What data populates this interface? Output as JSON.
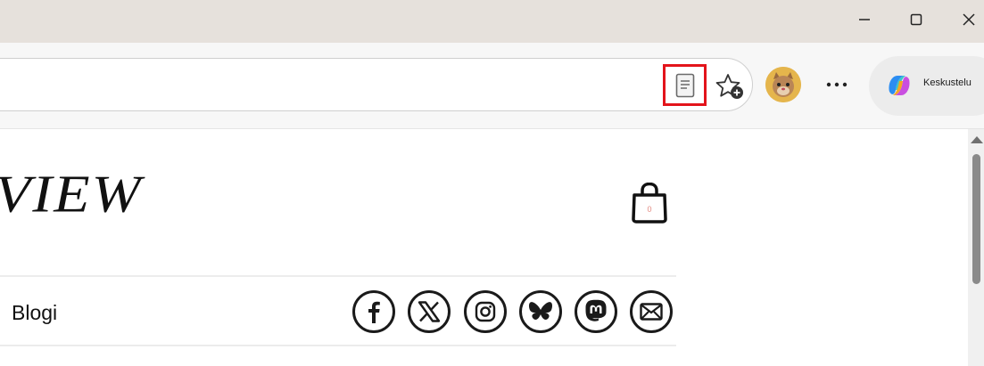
{
  "window": {
    "controls": [
      "minimize-icon",
      "maximize-icon",
      "close-icon"
    ]
  },
  "toolbar": {
    "reader_icon": "reader-view-icon",
    "favorites_icon": "add-favorite-icon",
    "profile_icon": "profile-avatar-icon",
    "more_icon": "more-options-icon",
    "copilot_label": "Keskustelu"
  },
  "page": {
    "logo_text": "VIEW",
    "bag_icon": "shopping-bag-icon",
    "nav_label": "Blogi",
    "social_icons": [
      "facebook-icon",
      "x-icon",
      "instagram-icon",
      "bluesky-icon",
      "mastodon-icon",
      "email-icon"
    ]
  },
  "colors": {
    "highlight": "#e3141b",
    "titlebar": "#e6e1dc",
    "toolbar": "#f7f7f7"
  }
}
